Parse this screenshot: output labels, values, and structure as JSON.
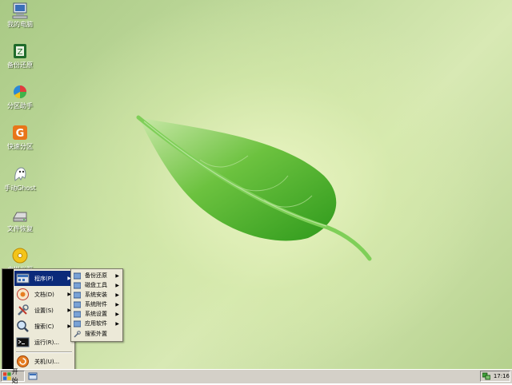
{
  "desktop": {
    "icons": [
      {
        "label": "我的电脑",
        "icon": "computer-icon"
      },
      {
        "label": "备份还原",
        "icon": "backup-icon"
      },
      {
        "label": "分区助手",
        "icon": "partition-assistant-icon"
      },
      {
        "label": "快速分区",
        "icon": "quick-partition-icon"
      },
      {
        "label": "手动Ghost",
        "icon": "ghost-icon"
      },
      {
        "label": "文件恢复",
        "icon": "file-recovery-icon"
      },
      {
        "label": "虚拟光驱",
        "icon": "virtual-drive-icon"
      }
    ]
  },
  "start_menu": {
    "items": [
      {
        "label": "程序(P)",
        "icon": "programs-icon",
        "has_submenu": true
      },
      {
        "label": "文档(D)",
        "icon": "documents-icon",
        "has_submenu": true
      },
      {
        "label": "设置(S)",
        "icon": "settings-icon",
        "has_submenu": true
      },
      {
        "label": "搜索(C)",
        "icon": "search-icon",
        "has_submenu": true
      },
      {
        "label": "运行(R)...",
        "icon": "run-icon",
        "has_submenu": false
      },
      {
        "label": "关机(U)...",
        "icon": "shutdown-icon",
        "has_submenu": false
      }
    ],
    "active_item": "程序(P)"
  },
  "programs_submenu": {
    "items": [
      {
        "label": "备份还原",
        "icon": "folder-icon",
        "has_submenu": true
      },
      {
        "label": "磁盘工具",
        "icon": "folder-icon",
        "has_submenu": true
      },
      {
        "label": "系统安装",
        "icon": "folder-icon",
        "has_submenu": true
      },
      {
        "label": "系统附件",
        "icon": "folder-icon",
        "has_submenu": true
      },
      {
        "label": "系统设置",
        "icon": "folder-icon",
        "has_submenu": true
      },
      {
        "label": "应用软件",
        "icon": "folder-icon",
        "has_submenu": true
      },
      {
        "label": "搜索外置",
        "icon": "search-plugin-icon",
        "has_submenu": false
      }
    ]
  },
  "taskbar": {
    "start_label": "开始",
    "clock": "17:16"
  },
  "colors": {
    "menu_highlight": "#0b2a7a",
    "menu_background": "#ece9d8",
    "taskbar": "#d4d0c8",
    "leaf_green": "#4caf2a"
  }
}
